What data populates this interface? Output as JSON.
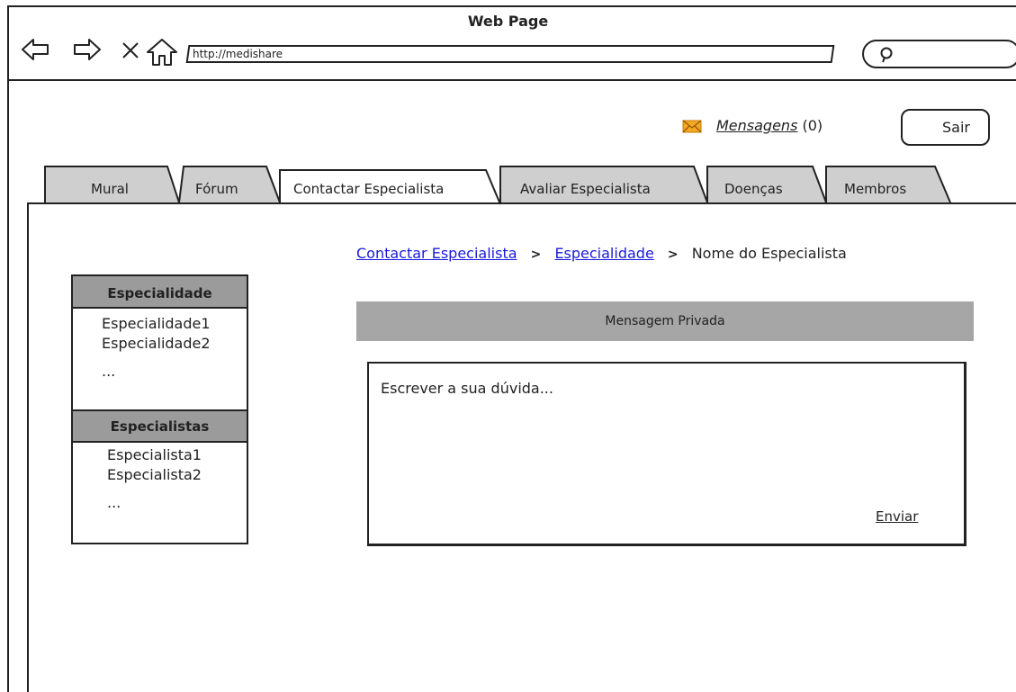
{
  "window": {
    "title": "Web Page",
    "url": "http://medishare"
  },
  "header": {
    "messages_label": "Mensagens",
    "messages_count": "(0)",
    "logout_label": "Sair"
  },
  "tabs": [
    {
      "label": "Mural",
      "active": false
    },
    {
      "label": "Fórum",
      "active": false
    },
    {
      "label": "Contactar Especialista",
      "active": true
    },
    {
      "label": "Avaliar Especialista",
      "active": false
    },
    {
      "label": "Doenças",
      "active": false
    },
    {
      "label": "Membros",
      "active": false
    }
  ],
  "breadcrumb": {
    "items": [
      "Contactar Especialista",
      "Especialidade",
      "Nome do Especialista"
    ],
    "separator": ">"
  },
  "sidebar": {
    "specialties_header": "Especialidade",
    "specialties": [
      "Especialidade1",
      "Especialidade2",
      "..."
    ],
    "specialists_header": "Especialistas",
    "specialists": [
      "Especialista1",
      "Especialista2",
      "..."
    ]
  },
  "main": {
    "section_title": "Mensagem Privada",
    "message_placeholder": "Escrever a sua dúvida...",
    "send_label": "Enviar"
  },
  "colors": {
    "link": "#1a1adc",
    "header_gray": "#9b9b9b",
    "bar_gray": "#a6a6a6",
    "tab_gray": "#cfcfcf",
    "mail_orange": "#f5a623"
  },
  "icons": [
    "back-arrow-icon",
    "forward-arrow-icon",
    "close-icon",
    "home-icon",
    "search-icon",
    "envelope-icon"
  ]
}
